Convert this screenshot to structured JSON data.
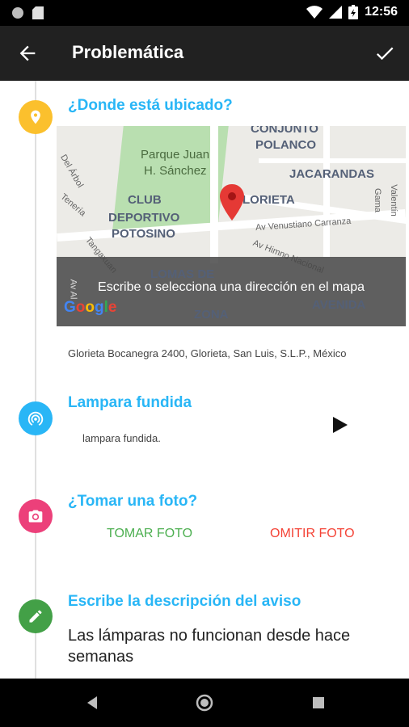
{
  "status_bar": {
    "time": "12:56"
  },
  "app_bar": {
    "title": "Problemática"
  },
  "location": {
    "title": "¿Donde está ubicado?",
    "map": {
      "labels": {
        "conjunto": "CONJUNTO",
        "polanco": "POLANCO",
        "jacarandas": "JACARANDAS",
        "parque_1": "Parque Juan",
        "parque_2": "H. Sánchez",
        "club_1": "CLUB",
        "club_2": "DEPORTIVO",
        "club_3": "POTOSINO",
        "glorieta": "LORIETA",
        "lomas": "LOMAS DE",
        "zona": "ZONA",
        "avenida": "AVENIDA",
        "del_arbol": "Del Árbol",
        "teneria": "Tenería",
        "tangaxuan": "Tangaxuan",
        "av_venustiano": "Av Venustiano Carranza",
        "av_himno": "Av Himno Nacional",
        "valentin": "Valentín Gama",
        "av_al": "Av Al"
      },
      "overlay_text": "Escribe o selecciona una dirección en el mapa",
      "google": [
        "G",
        "o",
        "o",
        "g",
        "l",
        "e"
      ]
    },
    "address": "Glorieta Bocanegra 2400, Glorieta, San Luis, S.L.P., México"
  },
  "problem": {
    "title": "Lampara fundida",
    "subtitle": "lampara fundida."
  },
  "photo": {
    "title": "¿Tomar una foto?",
    "take_label": "TOMAR FOTO",
    "skip_label": "OMITIR FOTO"
  },
  "description": {
    "title": "Escribe la descripción del aviso",
    "text": "Las lámparas no funcionan desde hace semanas"
  },
  "colors": {
    "location_icon": "#fbc02d",
    "problem_icon": "#29b6f6",
    "photo_icon": "#ec407a",
    "description_icon": "#43a047",
    "accent": "#29b6f6",
    "take_photo": "#4caf50",
    "skip_photo": "#f44336"
  },
  "icons": {
    "location": "location-pin-icon",
    "problem": "wifi-tethering-icon",
    "photo": "camera-icon",
    "description": "pencil-icon"
  }
}
